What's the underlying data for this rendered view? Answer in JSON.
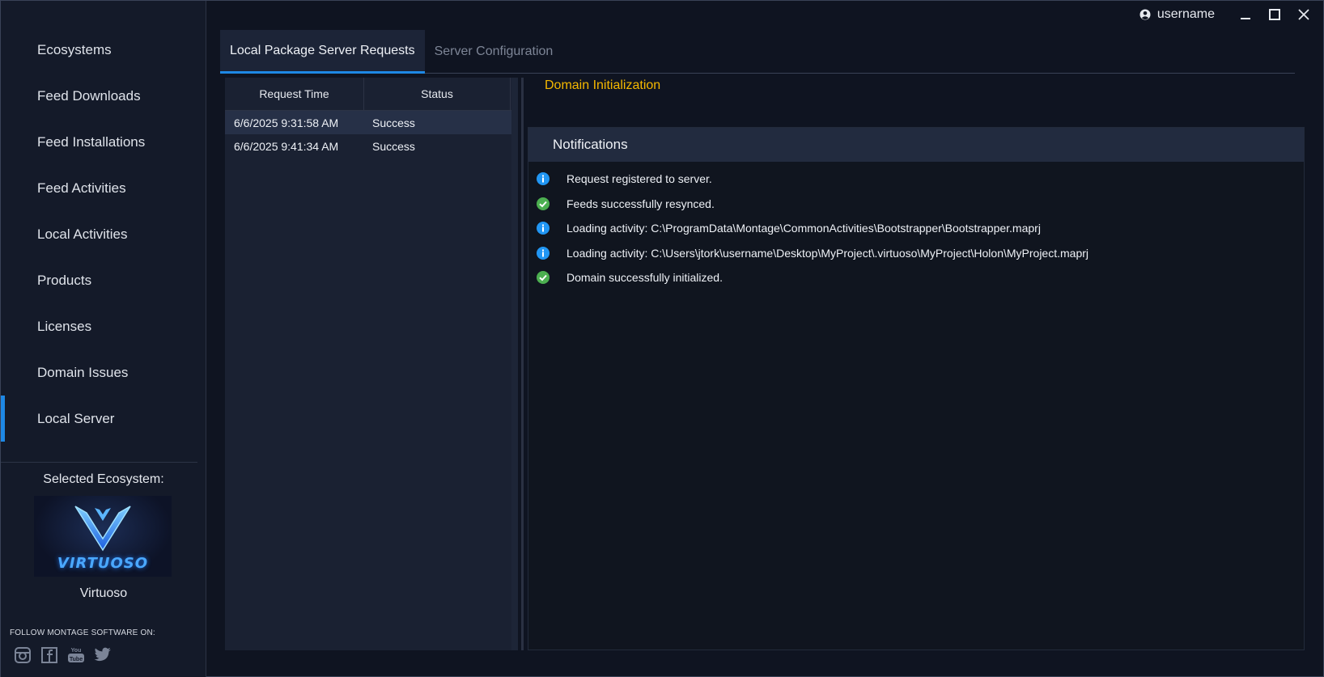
{
  "titlebar": {
    "username": "username",
    "icons": [
      "user-icon",
      "minimize-icon",
      "maximize-icon",
      "close-icon"
    ]
  },
  "sidebar": {
    "items": [
      {
        "label": "Ecosystems"
      },
      {
        "label": "Feed Downloads"
      },
      {
        "label": "Feed Installations"
      },
      {
        "label": "Feed Activities"
      },
      {
        "label": "Local Activities"
      },
      {
        "label": "Products"
      },
      {
        "label": "Licenses"
      },
      {
        "label": "Domain Issues"
      },
      {
        "label": "Local Server",
        "active": true
      }
    ],
    "selected_ecosystem_label": "Selected Ecosystem:",
    "ecosystem_logo_text": "VIRTUOSO",
    "ecosystem_name": "Virtuoso",
    "follow_text": "FOLLOW MONTAGE SOFTWARE ON:",
    "socials": [
      "instagram-icon",
      "facebook-icon",
      "youtube-icon",
      "twitter-icon"
    ]
  },
  "tabs": [
    {
      "label": "Local Package Server Requests",
      "active": true
    },
    {
      "label": "Server Configuration",
      "active": false
    }
  ],
  "requests": {
    "columns": [
      "Request Time",
      "Status"
    ],
    "rows": [
      {
        "time": "6/6/2025 9:31:58 AM",
        "status": "Success",
        "selected": true
      },
      {
        "time": "6/6/2025 9:41:34 AM",
        "status": "Success",
        "selected": false
      }
    ]
  },
  "detail": {
    "title": "Domain Initialization",
    "notifications_header": "Notifications",
    "notifications": [
      {
        "type": "info",
        "text": "Request registered to server."
      },
      {
        "type": "success",
        "text": "Feeds successfully resynced."
      },
      {
        "type": "info",
        "text": "Loading activity: C:\\ProgramData\\Montage\\CommonActivities\\Bootstrapper\\Bootstrapper.maprj"
      },
      {
        "type": "info",
        "text": "Loading activity: C:\\Users\\jtork\\username\\Desktop\\MyProject\\.virtuoso\\MyProject\\Holon\\MyProject.maprj"
      },
      {
        "type": "success",
        "text": "Domain successfully initialized."
      }
    ]
  },
  "colors": {
    "accent": "#1e88e5",
    "warning_title": "#f5b800",
    "info": "#2196f3",
    "success": "#4caf50"
  }
}
